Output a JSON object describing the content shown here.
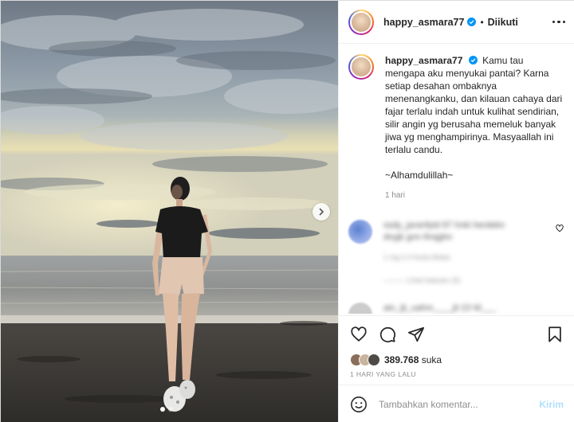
{
  "post": {
    "username": "happy_asmara77",
    "follow_status": "Diikuti",
    "caption_user": "happy_asmara77",
    "caption_text": "Kamu tau mengapa aku menyukai pantai? Karna setiap desahan ombaknya menenangkanku, dan kilauan cahaya dari fajar terlalu indah untuk kulihat sendirian, silir angin yg berusaha memeluk banyak jiwa yg menghampirinya. Masyaallah ini terlalu candu.\n\n~Alhamdulillah~",
    "caption_time": "1 hari",
    "likes_count": "389.768",
    "likes_suffix": "suka",
    "timestamp": "1 HARI YANG LALU"
  },
  "comments": [
    {
      "line1": "ssdy_jaranfytd 87 hnki herdekn",
      "line2": "dnyjk gnn thnjghn",
      "line3": "1 mg   2.0 fsuka   Balas",
      "line4": "———   Lihat balasan (5)"
    },
    {
      "line1": "ain_ijt_uahm____jil 23 W___",
      "line2": "",
      "line3": "",
      "line4": ""
    }
  ],
  "add_comment": {
    "placeholder": "Tambahkan komentar...",
    "post_label": "Kirim"
  },
  "icons": [
    "verified-badge-icon",
    "more-options-icon",
    "heart-icon",
    "comment-icon",
    "share-icon",
    "bookmark-icon",
    "emoji-icon",
    "chevron-right-icon"
  ],
  "colors": {
    "verified": "#0095f6",
    "post_button_disabled": "#b2dffc",
    "secondary_text": "#8e8e8e"
  }
}
